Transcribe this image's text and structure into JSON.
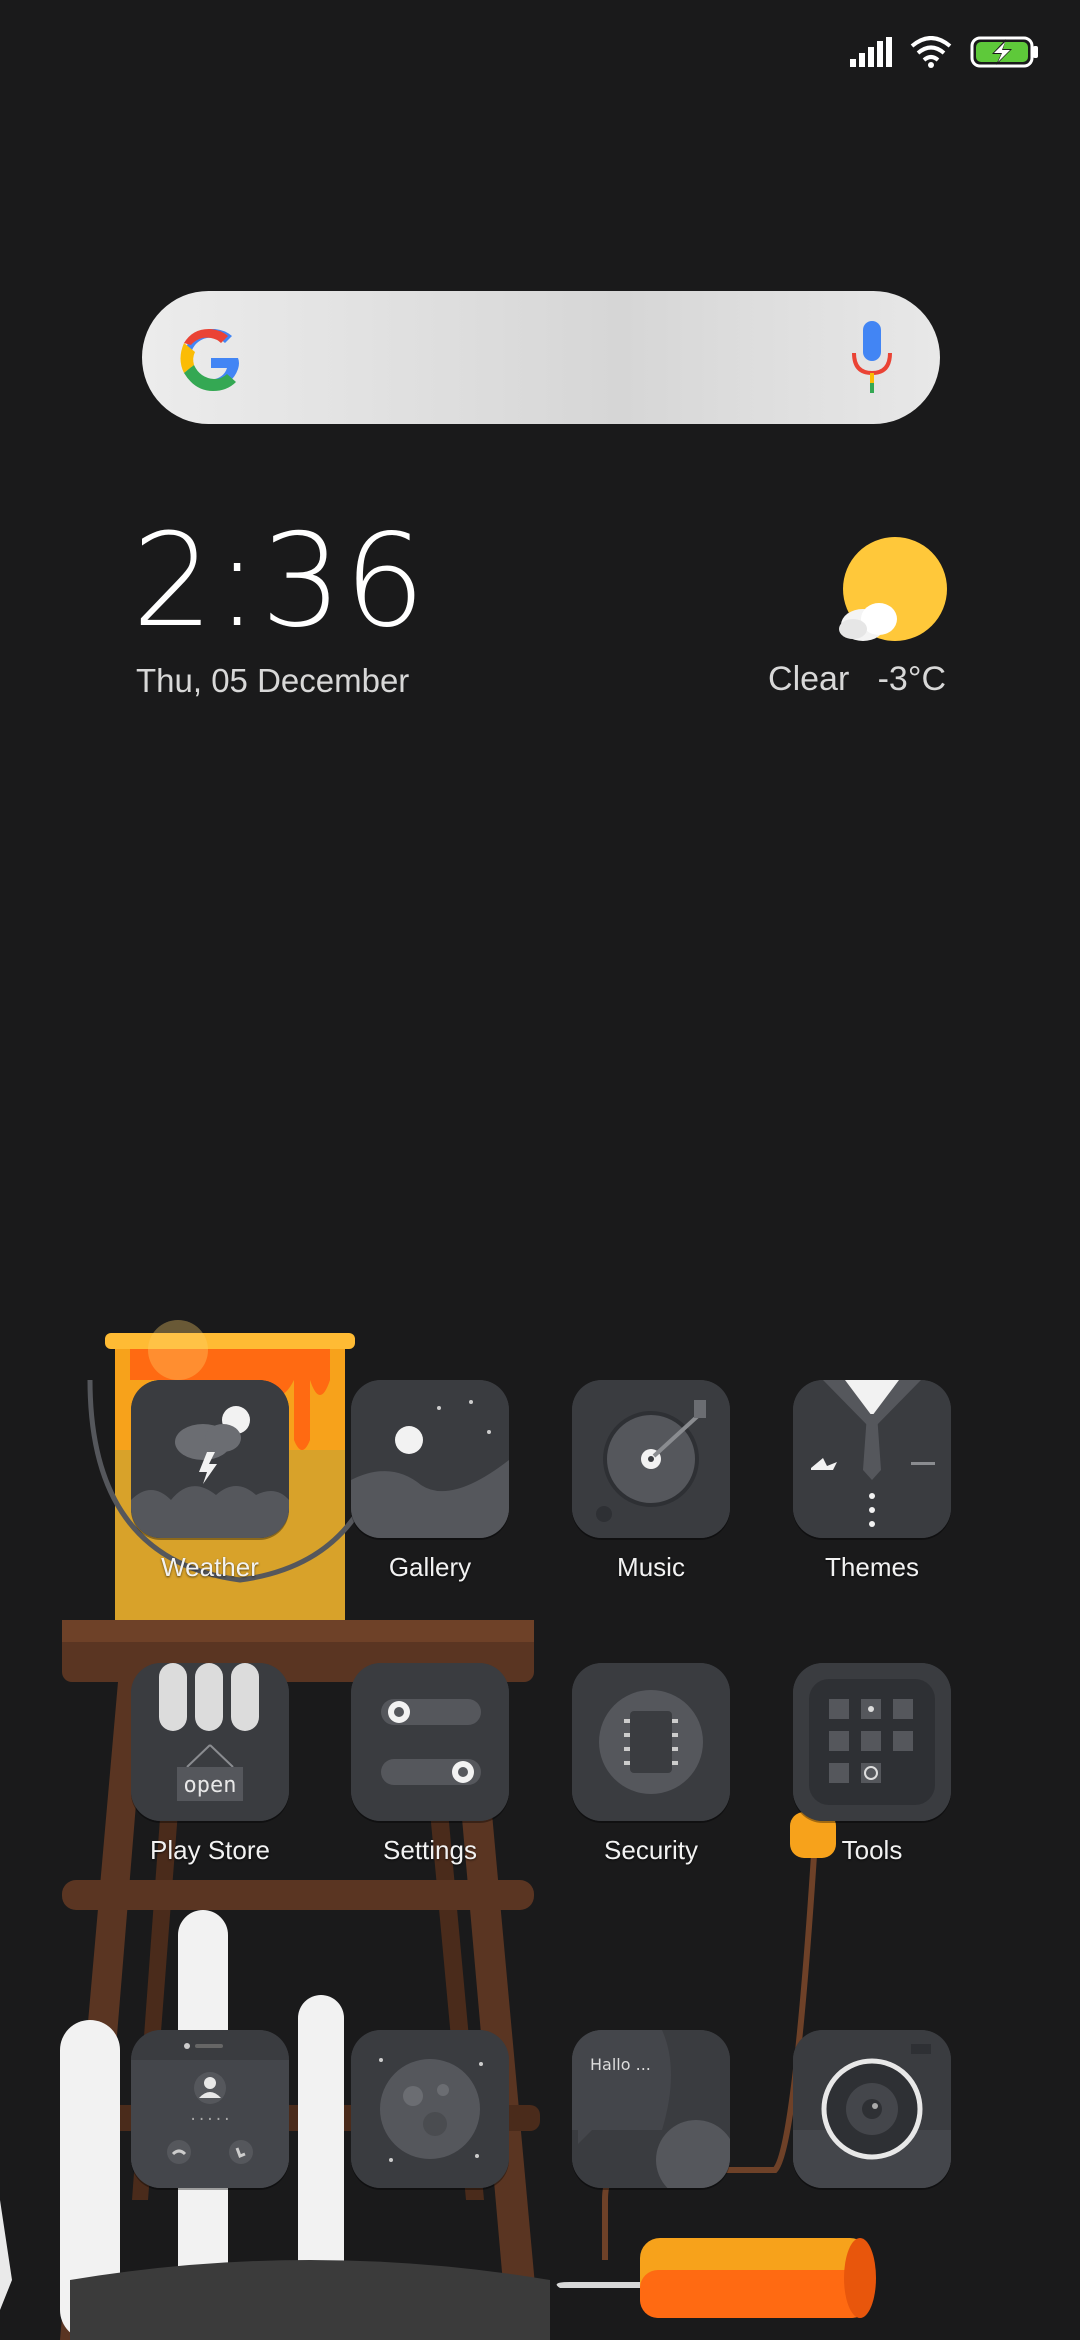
{
  "status_bar": {
    "icons": [
      "signal-icon",
      "wifi-icon",
      "battery-charging-icon"
    ],
    "battery_color": "#5ec93a"
  },
  "search_widget": {
    "logo": "google-g-icon",
    "mic": "mic-icon"
  },
  "clock_widget": {
    "time": "2:36",
    "date": "Thu, 05 December"
  },
  "weather_widget": {
    "condition": "Clear",
    "temperature": "-3°C",
    "icon": "sun-cloud-icon",
    "icon_color": "#ffc83a"
  },
  "apps": [
    {
      "label": "Weather",
      "icon": "weather-icon"
    },
    {
      "label": "Gallery",
      "icon": "gallery-icon"
    },
    {
      "label": "Music",
      "icon": "music-icon"
    },
    {
      "label": "Themes",
      "icon": "themes-icon"
    },
    {
      "label": "Play Store",
      "icon": "play-store-icon",
      "sign_text": "open"
    },
    {
      "label": "Settings",
      "icon": "settings-icon"
    },
    {
      "label": "Security",
      "icon": "security-icon"
    },
    {
      "label": "Tools",
      "icon": "tools-icon"
    }
  ],
  "dock": [
    {
      "icon": "phone-icon"
    },
    {
      "icon": "browser-icon"
    },
    {
      "icon": "messaging-icon",
      "text": "Hallo ..."
    },
    {
      "icon": "camera-icon"
    }
  ],
  "colors": {
    "background": "#1a1a1b",
    "tile": "#3a3c40",
    "accent_orange": "#f7a21b"
  }
}
